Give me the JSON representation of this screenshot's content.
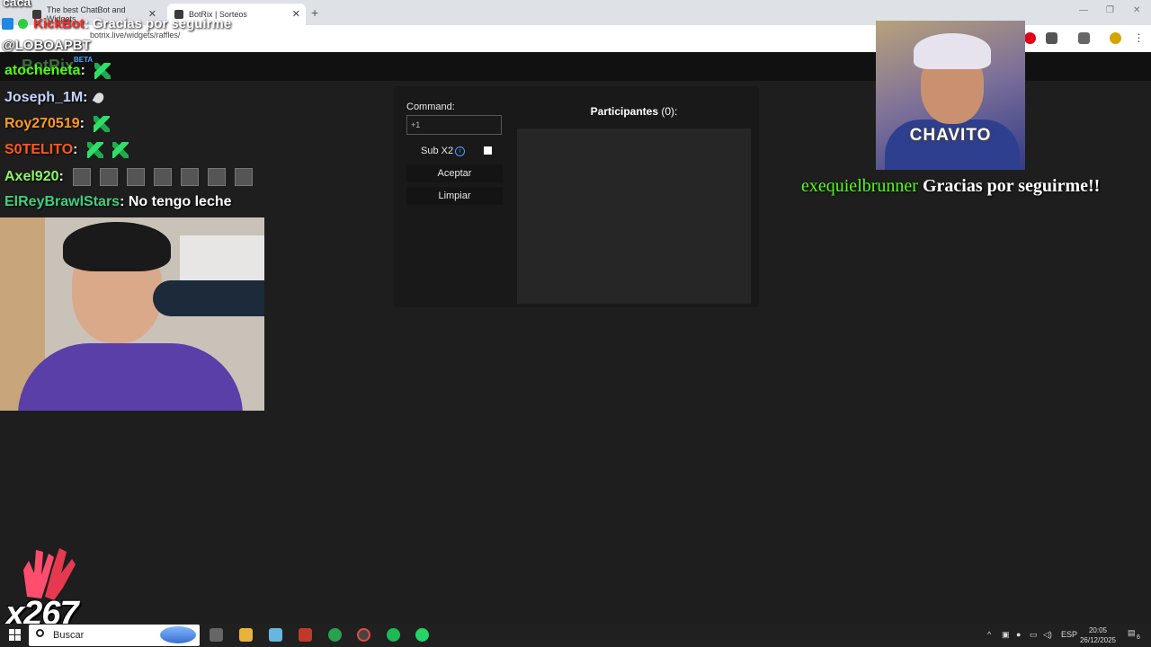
{
  "browser": {
    "tabs": [
      {
        "label": "The best ChatBot and Widgets"
      },
      {
        "label": "BotRix | Sorteos"
      }
    ],
    "url": "botrix.live/widgets/raffles/"
  },
  "site": {
    "logo": "BotRix",
    "beta": "BETA"
  },
  "raffle": {
    "command_label": "Command:",
    "command_value": "+1",
    "sub_x2_label": "Sub X2",
    "accept_label": "Aceptar",
    "clear_label": "Limpiar",
    "participants_label": "Participantes",
    "participants_count": "(0):"
  },
  "overlay": {
    "top_text": "caca",
    "kickbot_name": "KickBot",
    "kickbot_msg": ": Gracias por seguirme",
    "mention": "@LOBOAPBT",
    "chat": [
      {
        "user": "atocheneta",
        "color": "#53fc18",
        "suffix": " :",
        "emotes": "green"
      },
      {
        "user": "Joseph_1M",
        "color": "#c9d3ff",
        "suffix": " :",
        "emotes": "feather"
      },
      {
        "user": "Roy270519",
        "color": "#ff9a1f",
        "suffix": " :",
        "emotes": "green"
      },
      {
        "user": "S0TELITO",
        "color": "#ff5a1f",
        "suffix": " :",
        "emotes": "green2"
      },
      {
        "user": "Axel920",
        "color": "#8ef56a",
        "suffix": " :",
        "emotes": "boxes"
      },
      {
        "user": "ElReyBrawlStars",
        "color": "#3fd17f",
        "suffix": " : No tengo leche",
        "emotes": "none"
      }
    ],
    "cam2_caption": "CHAVITO",
    "follow_user": "exequielbrunner",
    "follow_msg": " Gracias por seguirme!!",
    "combo": "x267"
  },
  "taskbar": {
    "search_placeholder": "Buscar",
    "lang": "ESP",
    "time": "20:05",
    "date": "26/12/2025",
    "notifications": "6"
  }
}
